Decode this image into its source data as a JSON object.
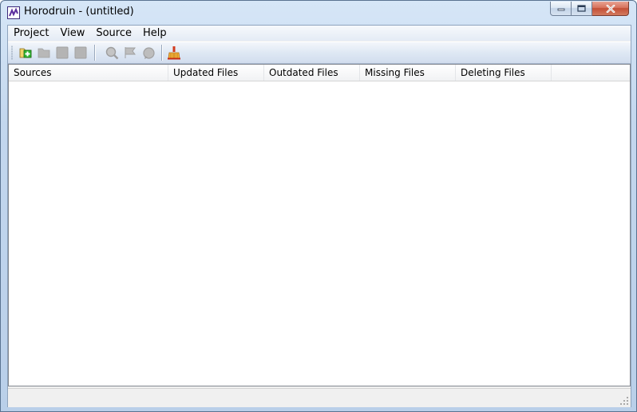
{
  "window": {
    "title": "Horodruin - (untitled)"
  },
  "caption_buttons": {
    "minimize_icon": "minimize-icon",
    "maximize_icon": "maximize-icon",
    "close_icon": "close-icon"
  },
  "menu": {
    "items": [
      {
        "label": "Project"
      },
      {
        "label": "View"
      },
      {
        "label": "Source"
      },
      {
        "label": "Help"
      }
    ]
  },
  "toolbar": {
    "buttons": [
      {
        "icon": "add-folder-icon",
        "enabled": true
      },
      {
        "icon": "open-folder-icon",
        "enabled": false
      },
      {
        "icon": "edit-icon",
        "enabled": false
      },
      {
        "icon": "remove-icon",
        "enabled": false
      },
      {
        "icon": "search-icon",
        "enabled": false
      },
      {
        "icon": "flag-icon",
        "enabled": false
      },
      {
        "icon": "refresh-icon",
        "enabled": false
      },
      {
        "icon": "clean-broom-icon",
        "enabled": true
      }
    ]
  },
  "list": {
    "columns": [
      "Sources",
      "Updated Files",
      "Outdated Files",
      "Missing Files",
      "Deleting Files"
    ],
    "rows": []
  },
  "statusbar": {
    "text": ""
  },
  "colors": {
    "title_gradient_top": "#d6e6f7",
    "close_button": "#c34f36",
    "app_icon": "#5b2d9e"
  }
}
